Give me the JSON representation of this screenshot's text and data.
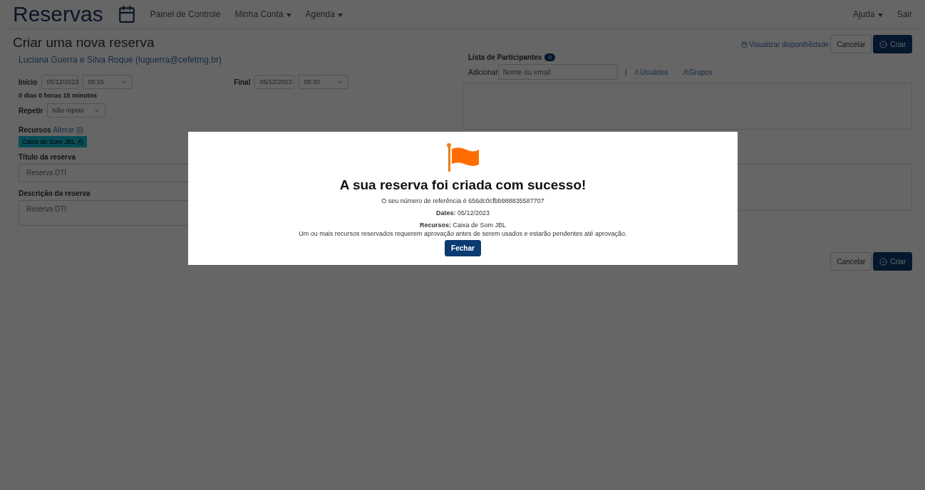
{
  "navbar": {
    "brand": "Reservas",
    "items": [
      {
        "label": "Painel de Controle",
        "dropdown": false
      },
      {
        "label": "Minha Conta",
        "dropdown": true
      },
      {
        "label": "Agenda",
        "dropdown": true
      }
    ],
    "right_items": [
      {
        "label": "Ajuda",
        "dropdown": true
      },
      {
        "label": "Sair",
        "dropdown": false
      }
    ]
  },
  "page": {
    "title": "Criar uma nova reserva",
    "owner": "Luciana Guerra e Silva Roque (luguerra@cefetmg.br)",
    "start": {
      "label": "Início",
      "date": "05/12/2023",
      "time": "09:15"
    },
    "end": {
      "label": "Final",
      "date": "05/12/2023",
      "time": "09:30"
    },
    "duration": "0 dias 0 horas 15 minutos",
    "repeat": {
      "label": "Repetir",
      "value": "Não repetir"
    },
    "resources": {
      "label": "Recursos",
      "change_link": "Alterar",
      "items": [
        {
          "name": "Caixa de Som JBL",
          "locked": true
        }
      ]
    },
    "title_field": {
      "label": "Título da reserva",
      "value": "Reserva DTI"
    },
    "description_field": {
      "label": "Descrição da reserva",
      "value": "Reserva DTI"
    },
    "availability_link": "Visualizar disponibilidade",
    "top_buttons": [
      "Cancelar",
      "Criar"
    ],
    "bottom_buttons": [
      "Cancelar",
      "Criar"
    ],
    "participants": {
      "label": "Lista de Participantes",
      "count": "0",
      "add_label": "Adicionar",
      "placeholder": "Nome ou email",
      "separator": "|",
      "users_link": "Usuários",
      "groups_link": "Grupos"
    }
  },
  "modal": {
    "heading": "A sua reserva foi criada com sucesso!",
    "reference": "O seu número de referência é 656dc0cfbb988835587707",
    "dates": "**Dates:** 05/12/2023",
    "resources": "**Recursos:** Caixa de Som JBL",
    "notice": "Um ou mais recursos reservados requerem aprovação antes de serem usados e estarão pendentes até aprovação.",
    "close_button": "Fechar"
  }
}
